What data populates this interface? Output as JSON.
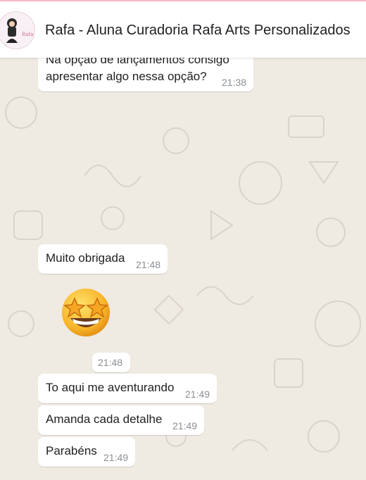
{
  "chat": {
    "title": "Rafa - Aluna Curadoria Rafa Arts Personalizados",
    "avatar": {
      "icon": "avatar-illustration-icon",
      "logo_text": "Rafa Arts"
    }
  },
  "messages": [
    {
      "line1": "Na opção de lançamentos consigo",
      "line2": "apresentar  algo nessa opção?",
      "time": "21:38"
    },
    {
      "text": "Muito obrigada",
      "time": "21:48"
    },
    {
      "emoji": "star-struck-emoji",
      "time": "21:48"
    },
    {
      "text": "To aqui me aventurando",
      "time": "21:49"
    },
    {
      "text": "Amanda cada detalhe",
      "time": "21:49"
    },
    {
      "text": "Parabéns",
      "time": "21:49"
    }
  ],
  "colors": {
    "background": "#efeae2",
    "bubble": "#ffffff",
    "timestamp": "#8a8f94",
    "header_border": "#f3b8c6"
  }
}
